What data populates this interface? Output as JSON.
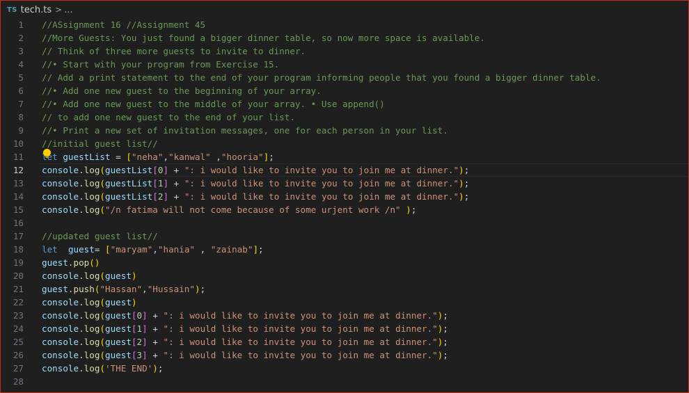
{
  "breadcrumb": {
    "lang_badge": "TS",
    "file": "tech.ts",
    "separator": ">",
    "more": "..."
  },
  "colors": {
    "background": "#1f1f1f",
    "comment": "#6a9955",
    "keyword": "#569cd6",
    "variable": "#9cdcfe",
    "function": "#dcdcaa",
    "string": "#ce9178",
    "number": "#b5cea8",
    "bracket_outer": "#ffd700",
    "bracket_inner": "#da70d6",
    "lightbulb": "#ffcc00",
    "window_border": "#c42b1c"
  },
  "icons": {
    "lightbulb": "lightbulb-icon",
    "ts": "typescript-icon"
  },
  "editor": {
    "current_line": 12,
    "lines": [
      {
        "n": "1",
        "t": "//ASsignment 16 //Assignment 45"
      },
      {
        "n": "2",
        "t": "//More Guests: You just found a bigger dinner table, so now more space is available."
      },
      {
        "n": "3",
        "t": "// Think of three more guests to invite to dinner."
      },
      {
        "n": "4",
        "t": "//• Start with your program from Exercise 15."
      },
      {
        "n": "5",
        "t": "// Add a print statement to the end of your program informing people that you found a bigger dinner table."
      },
      {
        "n": "6",
        "t": "//• Add one new guest to the beginning of your array."
      },
      {
        "n": "7",
        "t": "//• Add one new guest to the middle of your array. • Use append()"
      },
      {
        "n": "8",
        "t": "// to add one new guest to the end of your list."
      },
      {
        "n": "9",
        "t": "//• Print a new set of invitation messages, one for each person in your list."
      },
      {
        "n": "10",
        "t": "//initial guest list//"
      },
      {
        "n": "11",
        "t": "let guestList = [\"neha\",\"kanwal\" ,\"hooria\"];"
      },
      {
        "n": "12",
        "t": "console.log(guestList[0] + \": i would like to invite you to join me at dinner.\");"
      },
      {
        "n": "13",
        "t": "console.log(guestList[1] + \": i would like to invite you to join me at dinner.\");"
      },
      {
        "n": "14",
        "t": "console.log(guestList[2] + \": i would like to invite you to join me at dinner.\");"
      },
      {
        "n": "15",
        "t": "console.log(\"/n fatima will not come because of some urjent work /n\" );"
      },
      {
        "n": "16",
        "t": ""
      },
      {
        "n": "17",
        "t": "//updated guest list//"
      },
      {
        "n": "18",
        "t": "let  guest= [\"maryam\",\"hania\" , \"zainab\"];"
      },
      {
        "n": "19",
        "t": "guest.pop()"
      },
      {
        "n": "20",
        "t": "console.log(guest)"
      },
      {
        "n": "21",
        "t": "guest.push(\"Hassan\",\"Hussain\");"
      },
      {
        "n": "22",
        "t": "console.log(guest)"
      },
      {
        "n": "23",
        "t": "console.log(guest[0] + \": i would like to invite you to join me at dinner.\");"
      },
      {
        "n": "24",
        "t": "console.log(guest[1] + \": i would like to invite you to join me at dinner.\");"
      },
      {
        "n": "25",
        "t": "console.log(guest[2] + \": i would like to invite you to join me at dinner.\");"
      },
      {
        "n": "26",
        "t": "console.log(guest[3] + \": i would like to invite you to join me at dinner.\");"
      },
      {
        "n": "27",
        "t": "console.log('THE END');"
      },
      {
        "n": "28",
        "t": ""
      }
    ]
  }
}
